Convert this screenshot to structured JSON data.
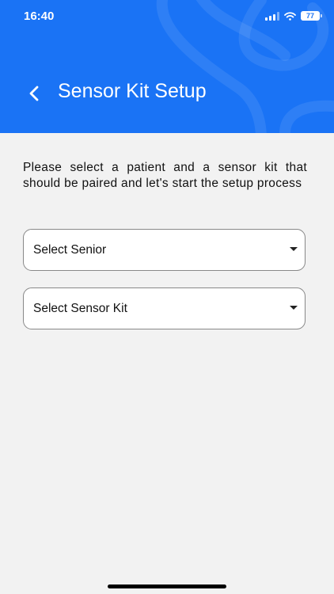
{
  "status_bar": {
    "time": "16:40",
    "battery": "77"
  },
  "header": {
    "title": "Sensor Kit Setup"
  },
  "main": {
    "description": "Please select a patient and a sensor kit that should be paired and let's start the setup process",
    "selects": [
      {
        "placeholder": "Select Senior"
      },
      {
        "placeholder": "Select Sensor Kit"
      }
    ]
  },
  "colors": {
    "primary": "#1a73f5",
    "background": "#f2f2f2"
  }
}
